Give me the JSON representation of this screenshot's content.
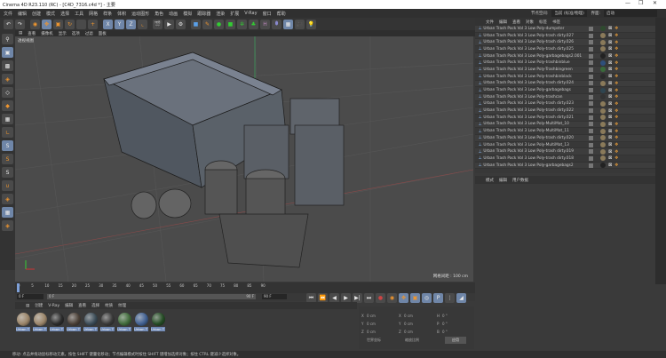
{
  "title": "Cinema 4D R23.110 (RC) - [C4D_7316.c4d *] - 主要",
  "window_controls": {
    "minimize": "—",
    "restore": "❐",
    "close": "✕"
  },
  "menu": [
    "文件",
    "编辑",
    "创建",
    "模式",
    "选择",
    "工具",
    "网格",
    "样条",
    "体积",
    "运动图形",
    "角色",
    "动画",
    "模拟",
    "跟踪器",
    "渲染",
    "扩展",
    "V-Ray",
    "窗口",
    "帮助"
  ],
  "toolbar": {
    "undo": "↶",
    "redo": "↷",
    "x": "X",
    "y": "Y",
    "z": "Z"
  },
  "node_space": {
    "label": "节点空间:",
    "value": "当前 (标准/物理)"
  },
  "layout": {
    "label": "界面:",
    "value": "启动"
  },
  "viewport": {
    "menu": [
      "查看",
      "摄像机",
      "显示",
      "选项",
      "过滤",
      "面板"
    ],
    "label": "透视视图",
    "grid_spacing": "网格间距 : 100 cm"
  },
  "object_manager": {
    "tabs": [
      "文件",
      "编辑",
      "查看",
      "对象",
      "标签",
      "书签"
    ],
    "objects": [
      {
        "name": "Urban Trash Pack Vol 3 Low Poly-dumpster",
        "mat": "#2e4a2e"
      },
      {
        "name": "Urban Trash Pack Vol 3 Low Poly-trash dirty.027",
        "mat": "#8a7a5a"
      },
      {
        "name": "Urban Trash Pack Vol 3 Low Poly-trash dirty.026",
        "mat": "#8a7a5a"
      },
      {
        "name": "Urban Trash Pack Vol 3 Low Poly-trash dirty.025",
        "mat": "#8a7a5a"
      },
      {
        "name": "Urban Trash Pack Vol 3 Low Poly-garbagebags2.001",
        "mat": "#222"
      },
      {
        "name": "Urban Trash Pack Vol 3 Low Poly-trashbinblue",
        "mat": "#2f4f7a"
      },
      {
        "name": "Urban Trash Pack Vol 3 Low Poly-Trashbingreen",
        "mat": "#3a6a3a"
      },
      {
        "name": "Urban Trash Pack Vol 3 Low Poly-trashbinblack",
        "mat": "#2a2a2a"
      },
      {
        "name": "Urban Trash Pack Vol 3 Low Poly-trash dirty.024",
        "mat": "#8a7a5a"
      },
      {
        "name": "Urban Trash Pack Vol 3 Low Poly-garbagebags",
        "mat": "#2f4550"
      },
      {
        "name": "Urban Trash Pack Vol 3 Low Poly-trashcan",
        "mat": "#333"
      },
      {
        "name": "Urban Trash Pack Vol 3 Low Poly-trash dirty.023",
        "mat": "#8a7a5a"
      },
      {
        "name": "Urban Trash Pack Vol 3 Low Poly-trash dirty.022",
        "mat": "#8a7a5a"
      },
      {
        "name": "Urban Trash Pack Vol 3 Low Poly-trash dirty.021",
        "mat": "#8a7a5a"
      },
      {
        "name": "Urban Trash Pack Vol 3 Low Poly-MultiMat_10",
        "mat": "#8a7a5a"
      },
      {
        "name": "Urban Trash Pack Vol 3 Low Poly-MultiMat_11",
        "mat": "#8a7a5a"
      },
      {
        "name": "Urban Trash Pack Vol 3 Low Poly-trash dirty.020",
        "mat": "#8a7a5a"
      },
      {
        "name": "Urban Trash Pack Vol 3 Low Poly-MultiMat_13",
        "mat": "#8a7a5a"
      },
      {
        "name": "Urban Trash Pack Vol 3 Low Poly-trash dirty.019",
        "mat": "#8a7a5a"
      },
      {
        "name": "Urban Trash Pack Vol 3 Low Poly-trash dirty.018",
        "mat": "#8a7a5a"
      },
      {
        "name": "Urban Trash Pack Vol 3 Low Poly-garbagebags2",
        "mat": "#222"
      }
    ]
  },
  "attributes": {
    "tabs": [
      "模式",
      "编辑",
      "用户数据"
    ]
  },
  "timeline": {
    "ticks": [
      "0",
      "5",
      "10",
      "15",
      "20",
      "25",
      "30",
      "35",
      "40",
      "45",
      "50",
      "55",
      "60",
      "65",
      "70",
      "75",
      "80",
      "85",
      "90"
    ],
    "current_frame": "0 F",
    "start": "0 F",
    "range_start": "0 F",
    "range_end": "90 F",
    "end": "90 F"
  },
  "material_manager": {
    "menu": [
      "创建",
      "V-Ray",
      "编辑",
      "查看",
      "选择",
      "材质",
      "纹理"
    ],
    "materials": [
      {
        "label": "Urban T",
        "color": "#9a8468"
      },
      {
        "label": "Urban T",
        "color": "#9a8468"
      },
      {
        "label": "Urban T",
        "color": "#2a2a2a"
      },
      {
        "label": "Urban T",
        "color": "#4a3f36"
      },
      {
        "label": "Urban T",
        "color": "#3a4a55"
      },
      {
        "label": "Urban T",
        "color": "#383838"
      },
      {
        "label": "Urban T",
        "color": "#3f6a3a"
      },
      {
        "label": "Urban T",
        "color": "#3f5f90"
      },
      {
        "label": "Urban T",
        "color": "#234a23"
      }
    ]
  },
  "coordinates": {
    "x_pos": "0 cm",
    "y_pos": "0 cm",
    "z_pos": "0 cm",
    "x_size": "0 cm",
    "y_size": "0 cm",
    "z_size": "0 cm",
    "h": "0 °",
    "p": "0 °",
    "b": "0 °",
    "mode": "世界坐标",
    "scale": "缩放比例",
    "apply": "应用",
    "labels": {
      "x": "X",
      "y": "Y",
      "z": "Z",
      "h": "H",
      "p": "P",
      "b": "B"
    }
  },
  "status": "移动: 点击并拖动鼠标移动元素。按住 SHIFT 键量化移动；节点编辑模式时按住 SHIFT 键增加选择对象；按住 CTRL 键减少选择对象。"
}
